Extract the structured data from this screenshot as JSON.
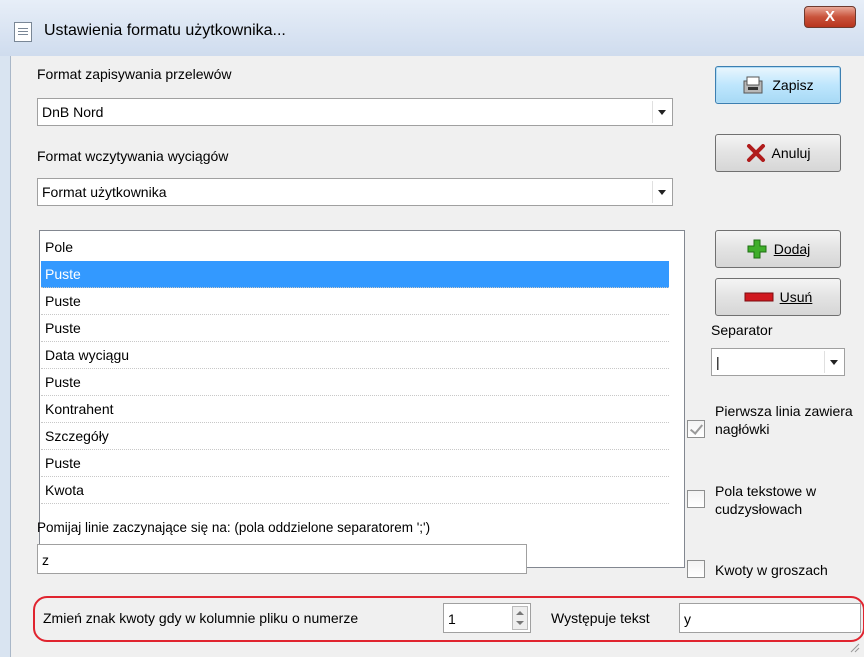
{
  "window": {
    "title": "Ustawienia formatu użytkownika...",
    "close_label": "X"
  },
  "save_format": {
    "label": "Format zapisywania przelewów",
    "value": "DnB Nord"
  },
  "read_format": {
    "label": "Format wczytywania wyciągów",
    "value": "Format użytkownika"
  },
  "buttons": {
    "save": "Zapisz",
    "cancel": "Anuluj",
    "add": "Dodaj",
    "remove": "Usuń"
  },
  "fields_list": {
    "header": "Pole",
    "rows": [
      "Puste",
      "Puste",
      "Puste",
      "Data wyciągu",
      "Puste",
      "Kontrahent",
      "Szczegóły",
      "Puste",
      "Kwota"
    ],
    "selected_index": 0
  },
  "separator": {
    "label": "Separator",
    "value": "|"
  },
  "options": {
    "first_line_headers": {
      "label": "Pierwsza linia zawiera nagłówki",
      "checked": true
    },
    "quoted_text_fields": {
      "label": "Pola tekstowe w cudzysłowach",
      "checked": false
    },
    "amounts_in_grosze": {
      "label": "Kwoty w groszach",
      "checked": false
    }
  },
  "skip_lines": {
    "label": "Pomijaj linie zaczynające się na: (pola oddzielone separatorem ';')",
    "value": "z"
  },
  "sign_change": {
    "label": "Zmień znak kwoty gdy w kolumnie pliku o numerze",
    "column_number": "1",
    "text_label": "Występuje tekst",
    "text_value": "y"
  },
  "colors": {
    "selection": "#3399ff",
    "highlight_frame": "#e0242f"
  }
}
